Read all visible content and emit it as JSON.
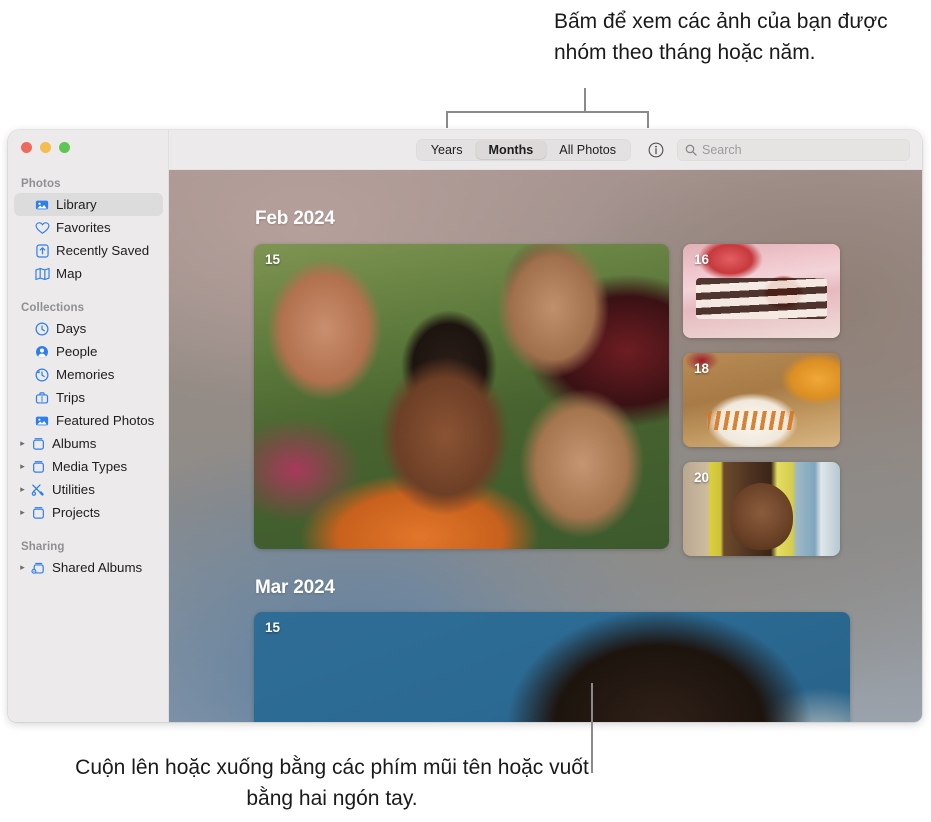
{
  "callouts": {
    "top": "Bấm để xem các ảnh của bạn được nhóm theo tháng hoặc năm.",
    "bottom": "Cuộn lên hoặc xuống bằng các phím mũi tên hoặc vuốt bằng hai ngón tay."
  },
  "window": {
    "traffic_lights": {
      "close_color": "#ed6a5e",
      "minimize_color": "#f4bd4f",
      "zoom_color": "#61c555"
    }
  },
  "sidebar": {
    "sections": [
      {
        "heading": "Photos",
        "items": [
          {
            "label": "Library",
            "icon": "library-icon",
            "selected": true,
            "disclosure": false
          },
          {
            "label": "Favorites",
            "icon": "heart-icon",
            "selected": false,
            "disclosure": false
          },
          {
            "label": "Recently Saved",
            "icon": "recently-saved-icon",
            "selected": false,
            "disclosure": false
          },
          {
            "label": "Map",
            "icon": "map-icon",
            "selected": false,
            "disclosure": false
          }
        ]
      },
      {
        "heading": "Collections",
        "items": [
          {
            "label": "Days",
            "icon": "clock-icon",
            "selected": false,
            "disclosure": false
          },
          {
            "label": "People",
            "icon": "person-icon",
            "selected": false,
            "disclosure": false
          },
          {
            "label": "Memories",
            "icon": "memories-icon",
            "selected": false,
            "disclosure": false
          },
          {
            "label": "Trips",
            "icon": "suitcase-icon",
            "selected": false,
            "disclosure": false
          },
          {
            "label": "Featured Photos",
            "icon": "featured-photos-icon",
            "selected": false,
            "disclosure": false
          },
          {
            "label": "Albums",
            "icon": "album-icon",
            "selected": false,
            "disclosure": true
          },
          {
            "label": "Media Types",
            "icon": "album-icon",
            "selected": false,
            "disclosure": true
          },
          {
            "label": "Utilities",
            "icon": "utilities-icon",
            "selected": false,
            "disclosure": true
          },
          {
            "label": "Projects",
            "icon": "album-icon",
            "selected": false,
            "disclosure": true
          }
        ]
      },
      {
        "heading": "Sharing",
        "items": [
          {
            "label": "Shared Albums",
            "icon": "shared-album-icon",
            "selected": false,
            "disclosure": true
          }
        ]
      }
    ]
  },
  "toolbar": {
    "segments": [
      {
        "label": "Years",
        "active": false
      },
      {
        "label": "Months",
        "active": true
      },
      {
        "label": "All Photos",
        "active": false
      }
    ],
    "info_button": "info-icon",
    "search": {
      "icon": "search-icon",
      "placeholder": "Search",
      "value": ""
    }
  },
  "library": {
    "months": [
      {
        "title": "Feb 2024",
        "photos": [
          {
            "day": "15",
            "name": "group-selfie-photo"
          },
          {
            "day": "16",
            "name": "cake-slice-photo"
          },
          {
            "day": "18",
            "name": "plated-food-photo"
          },
          {
            "day": "20",
            "name": "beach-portrait-photo"
          }
        ]
      },
      {
        "title": "Mar 2024",
        "photos": [
          {
            "day": "15",
            "name": "blue-backdrop-portrait-photo"
          }
        ]
      }
    ]
  }
}
